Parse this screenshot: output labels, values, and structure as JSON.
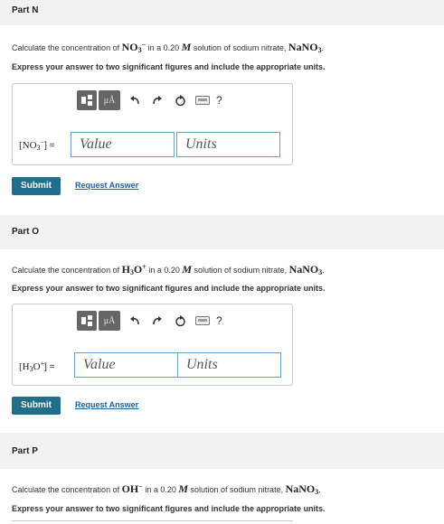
{
  "parts": [
    {
      "title": "Part N",
      "question_prefix": "Calculate the concentration of ",
      "species_main": "NO",
      "species_sub": "3",
      "species_sup": "−",
      "question_mid": " in a 0.20 ",
      "unit_var": "M",
      "question_suffix": " solution of sodium nitrate, ",
      "salt_main": "NaNO",
      "salt_sub": "3",
      "period": ".",
      "instruction": "Express your answer to two significant figures and include the appropriate units.",
      "lhs_open": "[NO",
      "lhs_sub": "3",
      "lhs_sup": "−",
      "lhs_close": "] =",
      "value_placeholder": "Value",
      "units_placeholder": "Units",
      "submit_label": "Submit",
      "request_label": "Request Answer"
    },
    {
      "title": "Part O",
      "question_prefix": "Calculate the concentration of ",
      "species_main": "H",
      "species_sub": "3",
      "species_main2": "O",
      "species_sup": "+",
      "question_mid": " in a 0.20 ",
      "unit_var": "M",
      "question_suffix": " solution of sodium nitrate, ",
      "salt_main": "NaNO",
      "salt_sub": "3",
      "period": ".",
      "instruction": "Express your answer to two significant figures and include the appropriate units.",
      "lhs_open": "[H",
      "lhs_sub": "3",
      "lhs_mid": "O",
      "lhs_sup": "+",
      "lhs_close": "] =",
      "value_placeholder": "Value",
      "units_placeholder": "Units",
      "submit_label": "Submit",
      "request_label": "Request Answer"
    },
    {
      "title": "Part P",
      "question_prefix": "Calculate the concentration of ",
      "species_main": "OH",
      "species_sup": "−",
      "question_mid": " in a 0.20 ",
      "unit_var": "M",
      "question_suffix": " solution of sodium nitrate, ",
      "salt_main": "NaNO",
      "salt_sub": "3",
      "period": ".",
      "instruction": "Express your answer to two significant figures and include the appropriate units."
    }
  ],
  "toolbar": {
    "mu_label": "μÅ",
    "help_label": "?",
    "icons": [
      "templates-icon",
      "units-icon",
      "undo-icon",
      "redo-icon",
      "reset-icon",
      "keyboard-icon",
      "help-icon"
    ]
  },
  "colors": {
    "header_bg": "#f2f2f2",
    "submit_bg": "#1f6f8b",
    "link": "#1f5f9b",
    "field_border": "#6aa3c8"
  }
}
